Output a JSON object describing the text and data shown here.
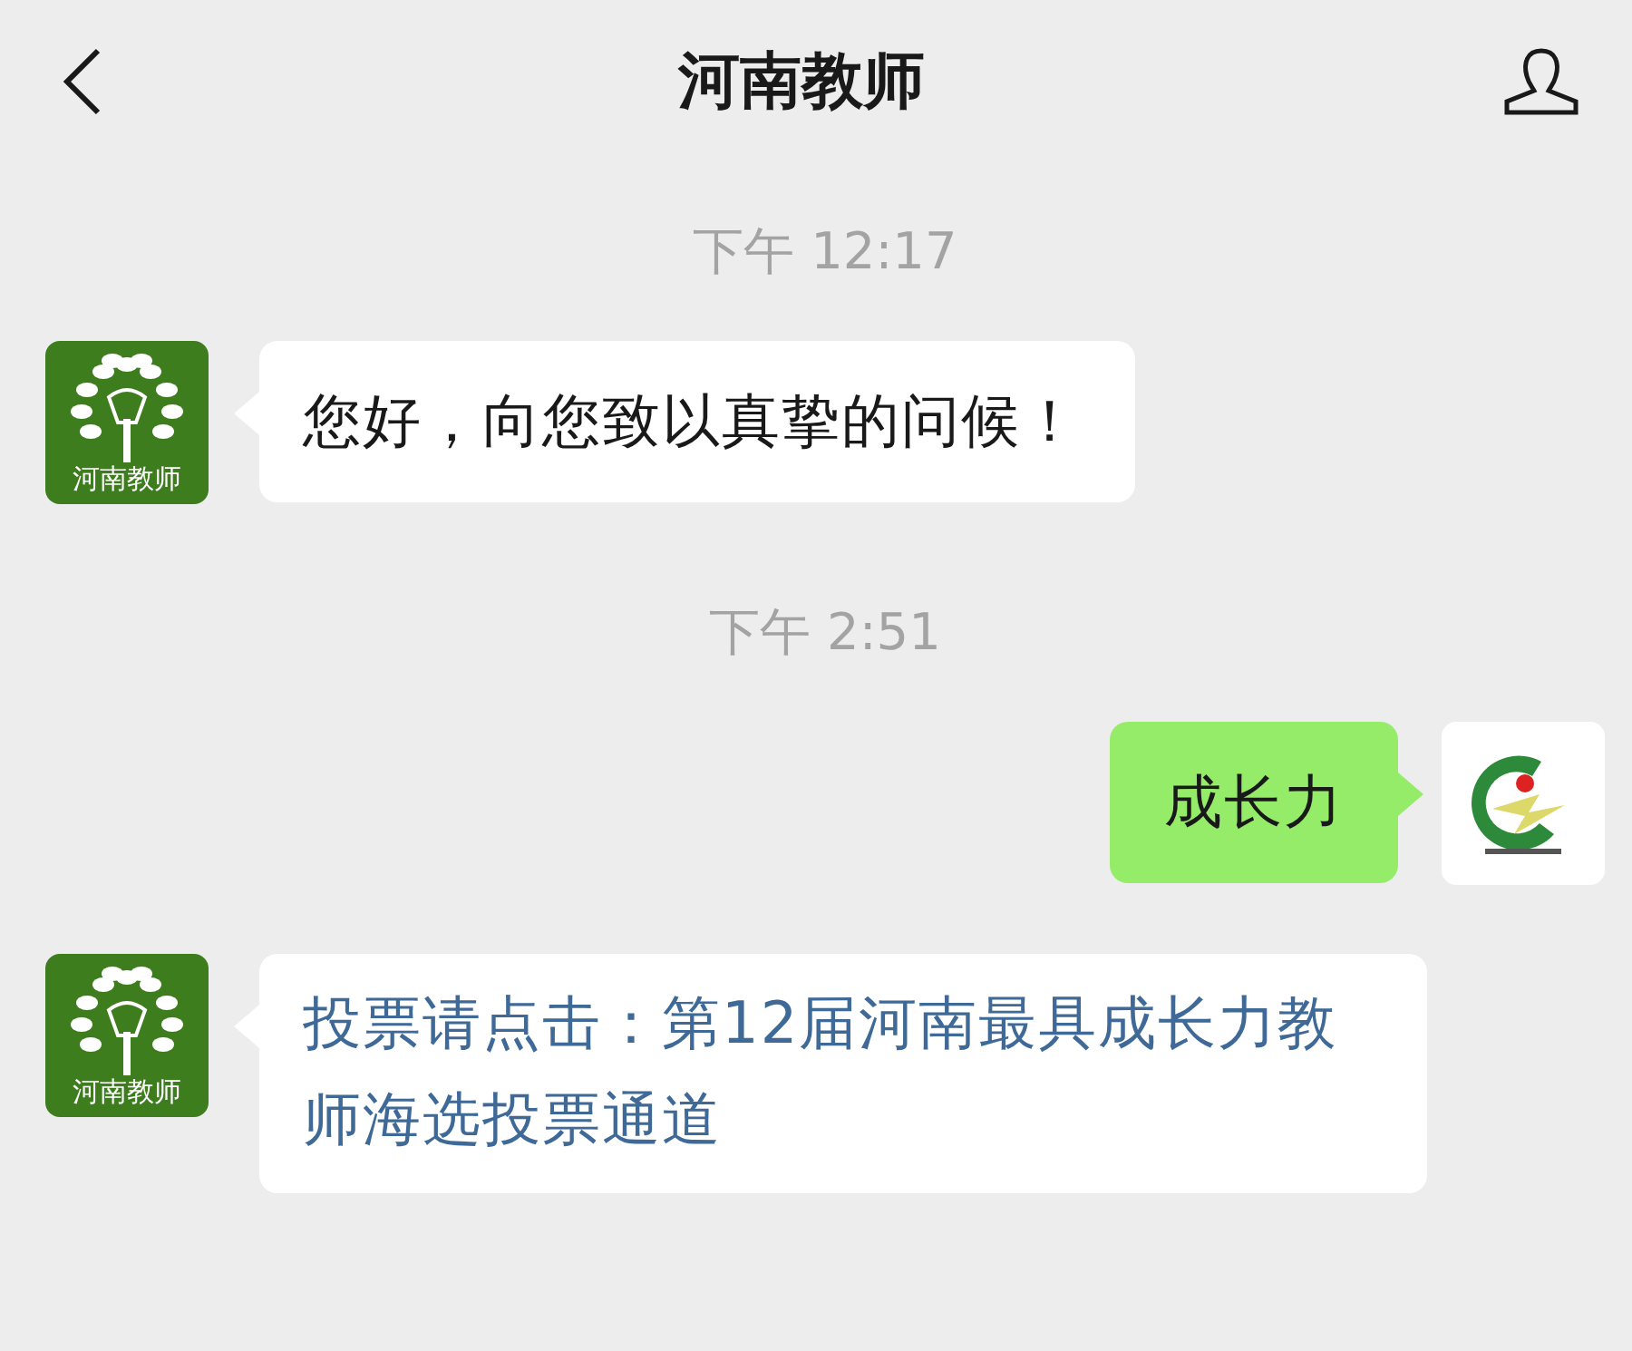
{
  "header": {
    "title": "河南教师"
  },
  "messages": [
    {
      "kind": "time",
      "text": "下午 12:17"
    },
    {
      "kind": "in",
      "avatar_label": "河南教师",
      "text": "您好，向您致以真挚的问候！"
    },
    {
      "kind": "time",
      "text": "下午 2:51"
    },
    {
      "kind": "out",
      "text": "成长力"
    },
    {
      "kind": "link",
      "avatar_label": "河南教师",
      "text": "投票请点击：第12届河南最具成长力教师海选投票通道"
    }
  ]
}
